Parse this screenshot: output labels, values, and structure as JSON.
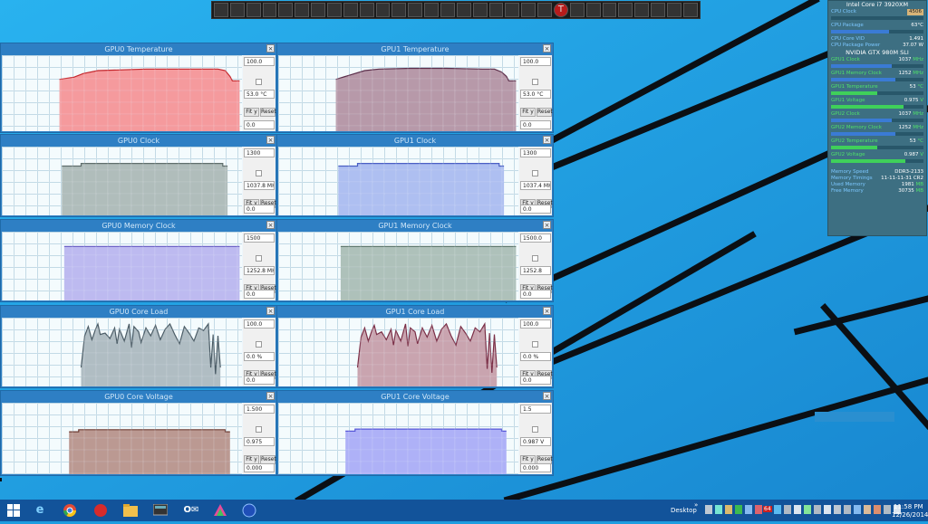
{
  "colors": {
    "desktop": "#1d9de0",
    "window_frame": "#2e7fc4",
    "panel_bg": "#3d6f82",
    "green_label": "#4fe06a",
    "blue_label": "#7cc7ff"
  },
  "toolbar": {
    "icons": [
      "monitor-icon",
      "cpu-icon",
      "chart-icon",
      "graph-icon",
      "cloud-icon",
      "sensor-icon",
      "clock-icon",
      "gauge-icon",
      "tools-icon",
      "flame-icon",
      "network-icon",
      "power-icon",
      "battery-icon",
      "disk-icon",
      "fan-icon",
      "ring-icon",
      "video-icon",
      "chip-icon",
      "refresh-icon",
      "eq-icon",
      "settings-icon",
      "temperature-icon",
      "display-icon",
      "speed-icon",
      "butterfly-icon",
      "pulse-icon",
      "star-icon",
      "sun-icon",
      "photo-icon",
      "power-icon"
    ],
    "temp_label": "T"
  },
  "graphs": [
    {
      "title": "GPU0 Temperature",
      "max": "100.0",
      "value": "53.0 °C",
      "min": "0.0",
      "fit": "Fit y",
      "reset": "Reset",
      "fill": "#f58f92",
      "stroke": "#c4262c",
      "profile": [
        [
          0.24,
          0
        ],
        [
          0.24,
          0.72
        ],
        [
          0.3,
          0.75
        ],
        [
          0.34,
          0.8
        ],
        [
          0.4,
          0.84
        ],
        [
          0.5,
          0.85
        ],
        [
          0.6,
          0.86
        ],
        [
          0.7,
          0.86
        ],
        [
          0.8,
          0.86
        ],
        [
          0.9,
          0.86
        ],
        [
          0.93,
          0.84
        ],
        [
          0.95,
          0.76
        ],
        [
          0.96,
          0.7
        ],
        [
          0.99,
          0.7
        ],
        [
          0.99,
          0
        ]
      ]
    },
    {
      "title": "GPU1 Temperature",
      "max": "100.0",
      "value": "53.0 °C",
      "min": "0.0",
      "fit": "Fit y",
      "reset": "Reset",
      "fill": "#b08ea0",
      "stroke": "#5b2e4a",
      "profile": [
        [
          0.24,
          0
        ],
        [
          0.24,
          0.72
        ],
        [
          0.3,
          0.78
        ],
        [
          0.36,
          0.84
        ],
        [
          0.42,
          0.86
        ],
        [
          0.55,
          0.87
        ],
        [
          0.7,
          0.87
        ],
        [
          0.85,
          0.86
        ],
        [
          0.9,
          0.86
        ],
        [
          0.93,
          0.82
        ],
        [
          0.95,
          0.76
        ],
        [
          0.96,
          0.7
        ],
        [
          0.99,
          0.7
        ],
        [
          0.99,
          0
        ]
      ]
    },
    {
      "title": "GPU0 Clock",
      "max": "1300",
      "value": "1037.8 MHz",
      "min": "0.0",
      "fit": "Fit y",
      "reset": "Reset",
      "fill": "#a9b6b4",
      "stroke": "#5f6e6c",
      "profile": [
        [
          0.25,
          0
        ],
        [
          0.25,
          0.76
        ],
        [
          0.33,
          0.76
        ],
        [
          0.33,
          0.8
        ],
        [
          0.92,
          0.8
        ],
        [
          0.92,
          0.76
        ],
        [
          0.94,
          0.76
        ],
        [
          0.94,
          0
        ]
      ]
    },
    {
      "title": "GPU1 Clock",
      "max": "1300",
      "value": "1037.4 MHz",
      "min": "0.0",
      "fit": "Fit y",
      "reset": "Reset",
      "fill": "#a6b8f0",
      "stroke": "#4a5fc4",
      "profile": [
        [
          0.25,
          0
        ],
        [
          0.25,
          0.76
        ],
        [
          0.33,
          0.76
        ],
        [
          0.33,
          0.8
        ],
        [
          0.92,
          0.8
        ],
        [
          0.92,
          0.76
        ],
        [
          0.94,
          0.76
        ],
        [
          0.94,
          0
        ]
      ]
    },
    {
      "title": "GPU0 Memory Clock",
      "max": "1500",
      "value": "1252.8 MHz",
      "min": "0.0",
      "fit": "Fit y",
      "reset": "Reset",
      "fill": "#b7b2ee",
      "stroke": "#6d63c8",
      "profile": [
        [
          0.26,
          0
        ],
        [
          0.26,
          0.83
        ],
        [
          0.99,
          0.83
        ],
        [
          0.99,
          0
        ]
      ]
    },
    {
      "title": "GPU1 Memory Clock",
      "max": "1500.0",
      "value": "1252.8",
      "min": "0.0",
      "fit": "Fit y",
      "reset": "Reset",
      "fill": "#a6bab2",
      "stroke": "#607a70",
      "profile": [
        [
          0.26,
          0
        ],
        [
          0.26,
          0.83
        ],
        [
          0.99,
          0.83
        ],
        [
          0.99,
          0
        ]
      ]
    },
    {
      "title": "GPU0 Core Load",
      "max": "100.0",
      "value": "0.0 %",
      "min": "0.0",
      "fit": "Fit y",
      "reset": "Reset",
      "fill": "#a8b6bd",
      "stroke": "#4b5c66",
      "spiky": true,
      "profile": [
        [
          0.33,
          0
        ],
        [
          0.33,
          0.3
        ],
        [
          0.345,
          0.78
        ],
        [
          0.36,
          0.92
        ],
        [
          0.375,
          0.72
        ],
        [
          0.39,
          0.88
        ],
        [
          0.4,
          0.96
        ],
        [
          0.41,
          0.8
        ],
        [
          0.43,
          0.82
        ],
        [
          0.45,
          0.74
        ],
        [
          0.47,
          0.9
        ],
        [
          0.48,
          0.66
        ],
        [
          0.49,
          0.88
        ],
        [
          0.51,
          0.7
        ],
        [
          0.53,
          0.96
        ],
        [
          0.54,
          0.6
        ],
        [
          0.55,
          0.92
        ],
        [
          0.57,
          0.84
        ],
        [
          0.58,
          0.68
        ],
        [
          0.6,
          0.9
        ],
        [
          0.62,
          0.78
        ],
        [
          0.64,
          0.94
        ],
        [
          0.66,
          0.72
        ],
        [
          0.68,
          0.88
        ],
        [
          0.7,
          0.96
        ],
        [
          0.72,
          0.8
        ],
        [
          0.74,
          0.66
        ],
        [
          0.76,
          0.92
        ],
        [
          0.78,
          0.82
        ],
        [
          0.8,
          0.7
        ],
        [
          0.82,
          0.9
        ],
        [
          0.84,
          0.86
        ],
        [
          0.86,
          0.96
        ],
        [
          0.87,
          0.3
        ],
        [
          0.88,
          0.8
        ],
        [
          0.89,
          0.2
        ],
        [
          0.9,
          0.78
        ],
        [
          0.91,
          0.3
        ],
        [
          0.91,
          0
        ]
      ]
    },
    {
      "title": "GPU1 Core Load",
      "max": "100.0",
      "value": "0.0 %",
      "min": "0.0",
      "fit": "Fit y",
      "reset": "Reset",
      "fill": "#c49aa6",
      "stroke": "#7a2e46",
      "spiky": true,
      "profile": [
        [
          0.33,
          0
        ],
        [
          0.33,
          0.3
        ],
        [
          0.345,
          0.76
        ],
        [
          0.36,
          0.9
        ],
        [
          0.375,
          0.7
        ],
        [
          0.39,
          0.86
        ],
        [
          0.4,
          0.94
        ],
        [
          0.41,
          0.8
        ],
        [
          0.43,
          0.84
        ],
        [
          0.45,
          0.72
        ],
        [
          0.47,
          0.88
        ],
        [
          0.48,
          0.64
        ],
        [
          0.49,
          0.86
        ],
        [
          0.51,
          0.7
        ],
        [
          0.53,
          0.96
        ],
        [
          0.54,
          0.62
        ],
        [
          0.55,
          0.9
        ],
        [
          0.57,
          0.84
        ],
        [
          0.58,
          0.66
        ],
        [
          0.6,
          0.9
        ],
        [
          0.62,
          0.76
        ],
        [
          0.64,
          0.94
        ],
        [
          0.66,
          0.7
        ],
        [
          0.68,
          0.88
        ],
        [
          0.7,
          0.96
        ],
        [
          0.72,
          0.78
        ],
        [
          0.74,
          0.64
        ],
        [
          0.76,
          0.92
        ],
        [
          0.78,
          0.82
        ],
        [
          0.8,
          0.7
        ],
        [
          0.82,
          0.9
        ],
        [
          0.84,
          0.84
        ],
        [
          0.86,
          0.96
        ],
        [
          0.87,
          0.28
        ],
        [
          0.88,
          0.82
        ],
        [
          0.89,
          0.22
        ],
        [
          0.9,
          0.8
        ],
        [
          0.91,
          0.3
        ],
        [
          0.91,
          0
        ]
      ]
    },
    {
      "title": "GPU0 Core Voltage",
      "max": "1.500",
      "value": "0.975",
      "min": "0.000",
      "fit": "Fit y",
      "reset": "Reset",
      "fill": "#b58e86",
      "stroke": "#6e3d34",
      "profile": [
        [
          0.28,
          0
        ],
        [
          0.28,
          0.63
        ],
        [
          0.32,
          0.63
        ],
        [
          0.32,
          0.66
        ],
        [
          0.93,
          0.66
        ],
        [
          0.93,
          0.63
        ],
        [
          0.95,
          0.63
        ],
        [
          0.95,
          0
        ]
      ]
    },
    {
      "title": "GPU1 Core Voltage",
      "max": "1.5",
      "value": "0.987 V",
      "min": "0.000",
      "fit": "Fit y",
      "reset": "Reset",
      "fill": "#a6a8f6",
      "stroke": "#5757d8",
      "profile": [
        [
          0.28,
          0
        ],
        [
          0.28,
          0.64
        ],
        [
          0.32,
          0.64
        ],
        [
          0.32,
          0.67
        ],
        [
          0.93,
          0.67
        ],
        [
          0.93,
          0.64
        ],
        [
          0.95,
          0.64
        ],
        [
          0.95,
          0
        ]
      ]
    }
  ],
  "sidepanel": {
    "cpu_title": "Intel Core i7 3920XM",
    "cpu_clock": {
      "label": "CPU Clock",
      "value": "4506"
    },
    "cpu_package": {
      "label": "CPU Package",
      "value": "63",
      "unit": "°C"
    },
    "cpu_vid": {
      "label": "CPU Core VID",
      "value": "1.491"
    },
    "cpu_power": {
      "label": "CPU Package Power",
      "value": "37.07 W"
    },
    "gpu_title": "NVIDIA GTX 980M SLI",
    "gpu_rows": [
      {
        "label": "GPU1 Clock",
        "value": "1037",
        "unit": "MHz",
        "level": 0.66,
        "color": "#3a7bd5"
      },
      {
        "label": "GPU1 Memory Clock",
        "value": "1252",
        "unit": "MHz",
        "level": 0.7,
        "color": "#3a7bd5"
      },
      {
        "label": "GPU1 Temperature",
        "value": "53",
        "unit": "°C",
        "level": 0.5,
        "color": "#3fd05a"
      },
      {
        "label": "GPU1 Voltage",
        "value": "0.975",
        "unit": "V",
        "level": 0.78,
        "color": "#3fd05a"
      },
      {
        "label": "GPU2 Clock",
        "value": "1037",
        "unit": "MHz",
        "level": 0.66,
        "color": "#3a7bd5"
      },
      {
        "label": "GPU2 Memory Clock",
        "value": "1252",
        "unit": "MHz",
        "level": 0.7,
        "color": "#3a7bd5"
      },
      {
        "label": "GPU2 Temperature",
        "value": "53",
        "unit": "°C",
        "level": 0.5,
        "color": "#3fd05a"
      },
      {
        "label": "GPU2 Voltage",
        "value": "0.987",
        "unit": "V",
        "level": 0.8,
        "color": "#3fd05a"
      }
    ],
    "memory": [
      {
        "label": "Memory Speed",
        "value": "DDR3-2133"
      },
      {
        "label": "Memory Timings",
        "value": "11-11-11-31 CR2"
      },
      {
        "label": "Used Memory",
        "value": "1981",
        "unit": "MB"
      },
      {
        "label": "Free Memory",
        "value": "30735",
        "unit": "MB"
      }
    ]
  },
  "taskbar": {
    "desktop_label": "Desktop",
    "chevron": "»",
    "time": "11:58 PM",
    "date": "12/26/2014",
    "badge": "64"
  }
}
